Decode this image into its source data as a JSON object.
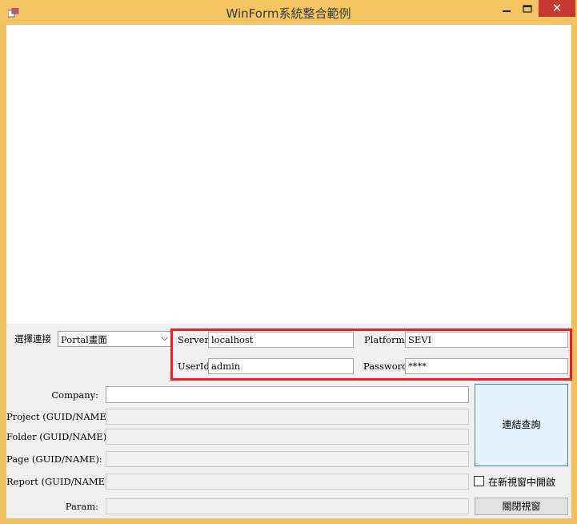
{
  "window": {
    "title": "WinForm系統整合範例",
    "close_glyph": "✕",
    "minimize_glyph": "—",
    "maximize_glyph": "☐"
  },
  "connection": {
    "select_label": "選擇連接",
    "select_value": "Portal畫面"
  },
  "server_panel": {
    "server_label": "Server",
    "server_value": "localhost",
    "platform_label": "Platform",
    "platform_value": "SEVI",
    "userid_label": "UserId",
    "userid_value": "admin",
    "password_label": "Password",
    "password_value": "****"
  },
  "form": {
    "company_label": "Company:",
    "company_value": "",
    "project_label": "Project (GUID/NAME):",
    "project_value": "",
    "folder_label": "Folder (GUID/NAME):",
    "folder_value": "",
    "page_label": "Page (GUID/NAME):",
    "page_value": "",
    "report_label": "Report (GUID/NAME):",
    "report_value": "",
    "param_label": "Param:",
    "param_value": ""
  },
  "actions": {
    "connect_query_label": "連結查詢",
    "new_window_label": "在新視窗中開啟",
    "new_window_checked": false,
    "close_window_label": "關閉視窗"
  },
  "colors": {
    "title_bar": "#f3c462",
    "close_button": "#c7372f",
    "highlight_border": "#e8202a"
  }
}
